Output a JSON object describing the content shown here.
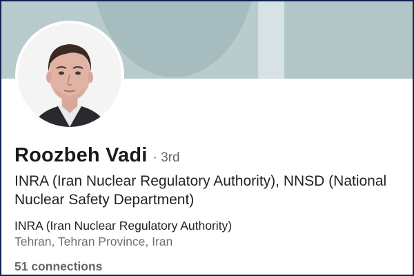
{
  "profile": {
    "name": "Roozbeh Vadi",
    "degree": "· 3rd",
    "headline": "INRA (Iran Nuclear Regulatory Authority), NNSD (National Nuclear Safety Department)",
    "company": "INRA (Iran Nuclear Regulatory Authority)",
    "location": "Tehran, Tehran Province, Iran",
    "connections": "51 connections"
  },
  "icons": {
    "avatar": "profile-photo"
  },
  "colors": {
    "banner": "#b9cccd",
    "name_text": "#1a1a1a",
    "secondary_text": "#707070",
    "frame_border": "#0f2454"
  }
}
